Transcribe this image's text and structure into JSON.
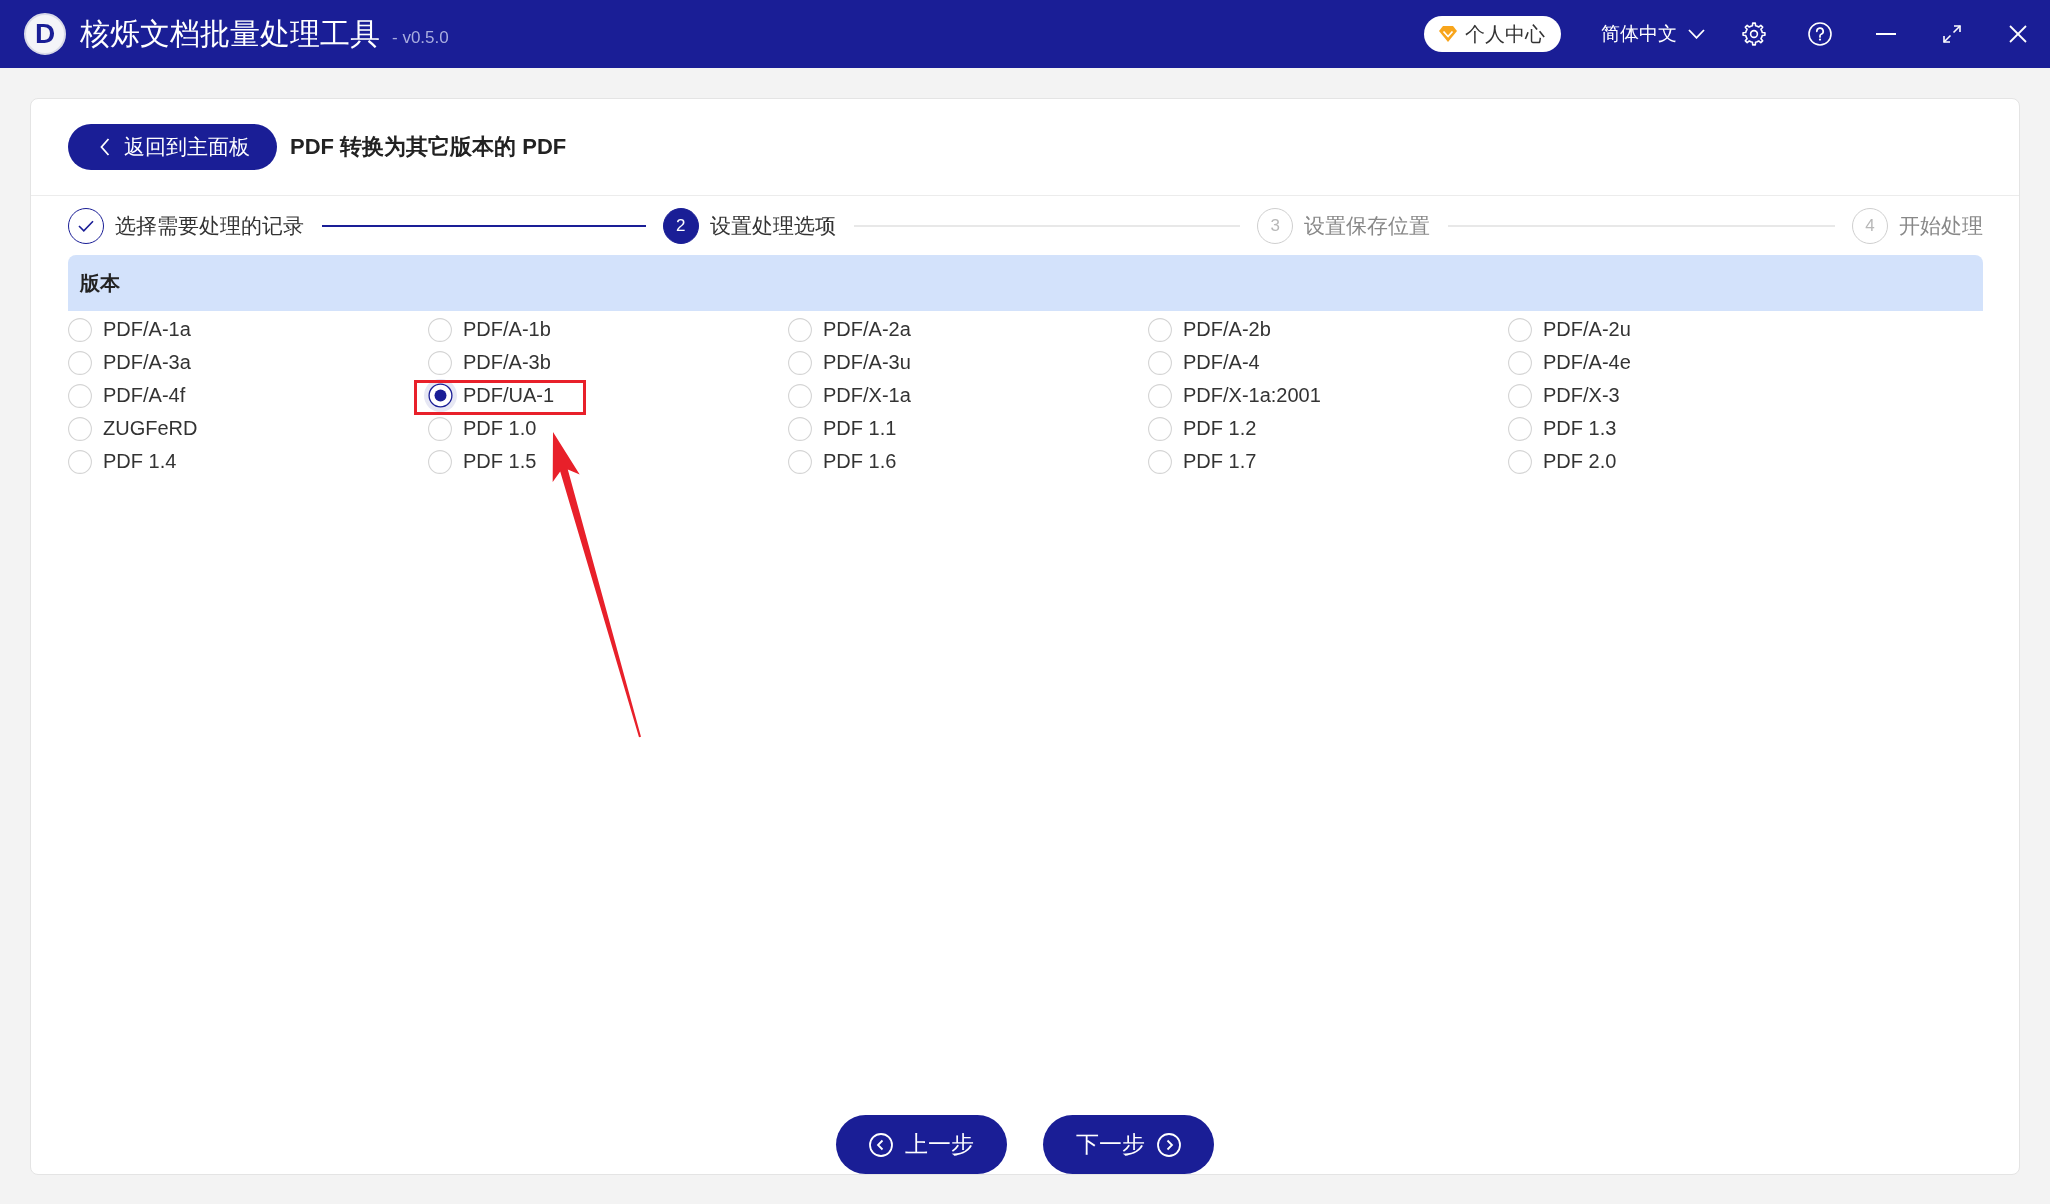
{
  "window": {
    "logo": "D",
    "title": "核烁文档批量处理工具",
    "version": "- v0.5.0"
  },
  "title_bar": {
    "account_button": "个人中心",
    "language": "简体中文"
  },
  "header": {
    "back_button": "返回到主面板",
    "title": "PDF 转换为其它版本的 PDF"
  },
  "steps": [
    {
      "label": "选择需要处理的记录",
      "completed": true,
      "current": false
    },
    {
      "number": "2",
      "label": "设置处理选项",
      "completed": false,
      "current": true
    },
    {
      "number": "3",
      "label": "设置保存位置",
      "completed": false,
      "current": false
    },
    {
      "number": "4",
      "label": "开始处理",
      "completed": false,
      "current": false
    }
  ],
  "version_section": {
    "title": "版本",
    "options": [
      {
        "label": "PDF/A-1a",
        "selected": false,
        "highlighted": false
      },
      {
        "label": "PDF/A-1b",
        "selected": false,
        "highlighted": false
      },
      {
        "label": "PDF/A-2a",
        "selected": false,
        "highlighted": false
      },
      {
        "label": "PDF/A-2b",
        "selected": false,
        "highlighted": false
      },
      {
        "label": "PDF/A-2u",
        "selected": false,
        "highlighted": false
      },
      {
        "label": "PDF/A-3a",
        "selected": false,
        "highlighted": false
      },
      {
        "label": "PDF/A-3b",
        "selected": false,
        "highlighted": false
      },
      {
        "label": "PDF/A-3u",
        "selected": false,
        "highlighted": false
      },
      {
        "label": "PDF/A-4",
        "selected": false,
        "highlighted": false
      },
      {
        "label": "PDF/A-4e",
        "selected": false,
        "highlighted": false
      },
      {
        "label": "PDF/A-4f",
        "selected": false,
        "highlighted": false
      },
      {
        "label": "PDF/UA-1",
        "selected": true,
        "highlighted": true
      },
      {
        "label": "PDF/X-1a",
        "selected": false,
        "highlighted": false
      },
      {
        "label": "PDF/X-1a:2001",
        "selected": false,
        "highlighted": false
      },
      {
        "label": "PDF/X-3",
        "selected": false,
        "highlighted": false
      },
      {
        "label": "ZUGFeRD",
        "selected": false,
        "highlighted": false
      },
      {
        "label": "PDF 1.0",
        "selected": false,
        "highlighted": false
      },
      {
        "label": "PDF 1.1",
        "selected": false,
        "highlighted": false
      },
      {
        "label": "PDF 1.2",
        "selected": false,
        "highlighted": false
      },
      {
        "label": "PDF 1.3",
        "selected": false,
        "highlighted": false
      },
      {
        "label": "PDF 1.4",
        "selected": false,
        "highlighted": false
      },
      {
        "label": "PDF 1.5",
        "selected": false,
        "highlighted": false
      },
      {
        "label": "PDF 1.6",
        "selected": false,
        "highlighted": false
      },
      {
        "label": "PDF 1.7",
        "selected": false,
        "highlighted": false
      },
      {
        "label": "PDF 2.0",
        "selected": false,
        "highlighted": false
      }
    ]
  },
  "footer": {
    "buttons": [
      {
        "kind": "previous",
        "label": "上一步"
      },
      {
        "kind": "next",
        "label": "下一步"
      }
    ]
  }
}
